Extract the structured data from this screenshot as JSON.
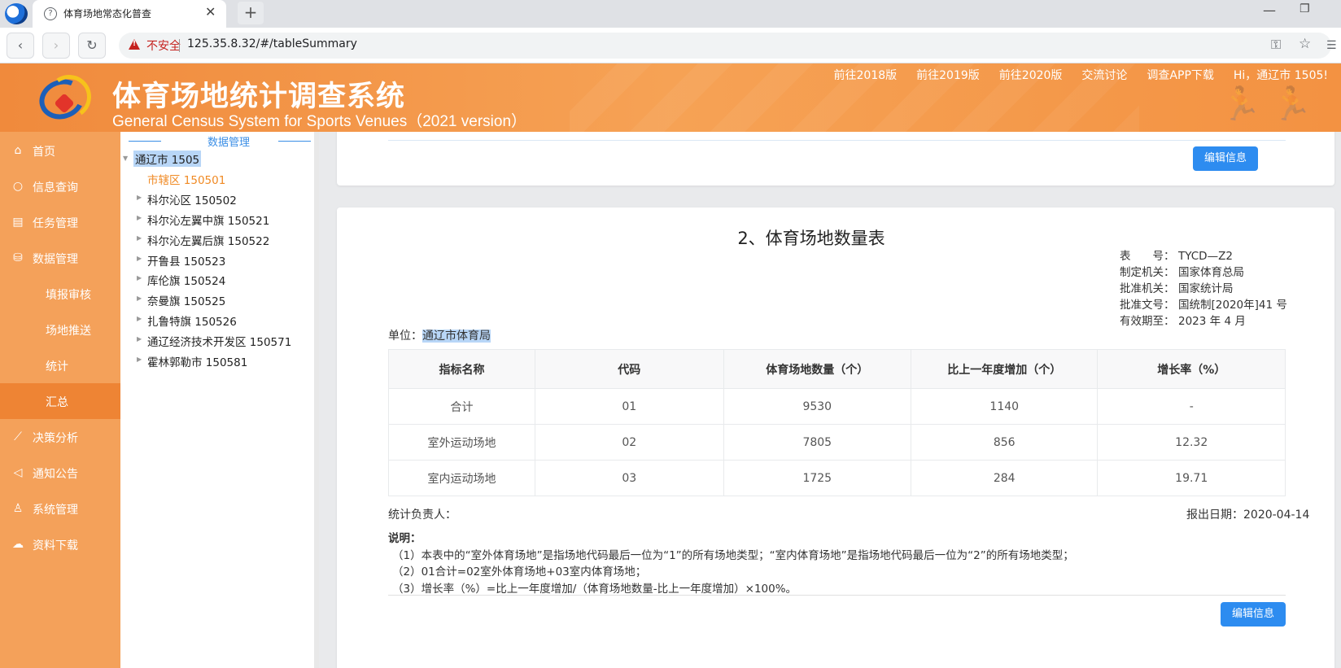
{
  "browser": {
    "tab_title": "体育场地常态化普查",
    "close": "✕",
    "new_tab": "+",
    "insecure": "不安全",
    "url": "125.35.8.32/#/tableSummary"
  },
  "header": {
    "title": "体育场地统计调查系统",
    "subtitle": "General Census System for Sports Venues（2021 version）",
    "nav": [
      "前往2018版",
      "前往2019版",
      "前往2020版",
      "交流讨论",
      "调查APP下载",
      "Hi，通辽市 1505!"
    ]
  },
  "sidebar": {
    "items": [
      {
        "icon": "home-icon",
        "label": "首页"
      },
      {
        "icon": "search-icon",
        "label": "信息查询"
      },
      {
        "icon": "task-icon",
        "label": "任务管理"
      },
      {
        "icon": "database-icon",
        "label": "数据管理"
      },
      {
        "label": "填报审核"
      },
      {
        "label": "场地推送"
      },
      {
        "label": "统计"
      },
      {
        "label": "汇总"
      },
      {
        "icon": "chart-icon",
        "label": "决策分析"
      },
      {
        "icon": "speaker-icon",
        "label": "通知公告"
      },
      {
        "icon": "user-icon",
        "label": "系统管理"
      },
      {
        "icon": "download-icon",
        "label": "资料下载"
      }
    ]
  },
  "tree": {
    "header": "数据管理",
    "root": "通辽市 1505",
    "nodes": [
      "市辖区 150501",
      "科尔沁区 150502",
      "科尔沁左翼中旗 150521",
      "科尔沁左翼后旗 150522",
      "开鲁县 150523",
      "库伦旗 150524",
      "奈曼旗 150525",
      "扎鲁特旗 150526",
      "通辽经济技术开发区 150571",
      "霍林郭勒市 150581"
    ]
  },
  "main": {
    "edit_label": "编辑信息",
    "report_title": "2、体育场地数量表",
    "meta": [
      {
        "k": "表　　号：",
        "v": "TYCD—Z2"
      },
      {
        "k": "制定机关：",
        "v": "国家体育总局"
      },
      {
        "k": "批准机关：",
        "v": "国家统计局"
      },
      {
        "k": "批准文号：",
        "v": "国统制[2020年]41 号"
      },
      {
        "k": "有效期至：",
        "v": "2023 年 4 月"
      }
    ],
    "unit_label": "单位：",
    "unit_value": "通辽市体育局",
    "table": {
      "headers": [
        "指标名称",
        "代码",
        "体育场地数量（个）",
        "比上一年度增加（个）",
        "增长率（%）"
      ],
      "rows": [
        [
          "合计",
          "01",
          "9530",
          "1140",
          "-"
        ],
        [
          "室外运动场地",
          "02",
          "7805",
          "856",
          "12.32"
        ],
        [
          "室内运动场地",
          "03",
          "1725",
          "284",
          "19.71"
        ]
      ]
    },
    "responsible": "统计负责人：",
    "report_date": "报出日期：2020-04-14",
    "notes_title": "说明：",
    "notes": [
      "（1）本表中的“室外体育场地”是指场地代码最后一位为“1”的所有场地类型；“室内体育场地”是指场地代码最后一位为“2”的所有场地类型；",
      "（2）01合计=02室外体育场地+03室内体育场地；",
      "（3）增长率（%）=比上一年度增加/（体育场地数量-比上一年度增加）×100%。"
    ]
  }
}
